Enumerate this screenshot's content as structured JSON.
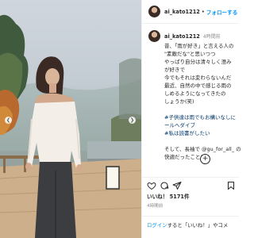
{
  "post": {
    "username": "ai_kato1212",
    "separator": "•",
    "follow_label": "フォローする",
    "time_ago": "4時間前",
    "caption_lines": [
      "昔、「雨が好き」と言える人の",
      "\"素敵だな\"と思いつつ",
      "やっぱり自分は清々しく澄み",
      "が好きで",
      "今でもそれは変わらないんだ",
      "最近、自然の中で感じる雨の",
      "しめるようになってきたの",
      "しょうか(笑)"
    ],
    "hashtag_lines": [
      "#子供達は雨でもお構いなしに",
      "ールへダイブ",
      "#私は読書がしたい"
    ],
    "end_lines": [
      "そして、長袖で @gu_for_all_ の",
      "快適だったこと！"
    ],
    "more_icon": "plus-circle-icon",
    "likes_label": "いいね！",
    "likes_count": "5171件",
    "posted": "4時間前",
    "login_prefix": "ログイン",
    "login_text": "すると「いいね！」やコメ"
  },
  "icons": {
    "heart": "heart-icon",
    "comment": "comment-icon",
    "share": "share-icon",
    "bookmark": "bookmark-icon"
  },
  "colors": {
    "accent": "#0095f6",
    "text": "#262626",
    "muted": "#8e8e8e",
    "hashtag": "#00376b"
  }
}
